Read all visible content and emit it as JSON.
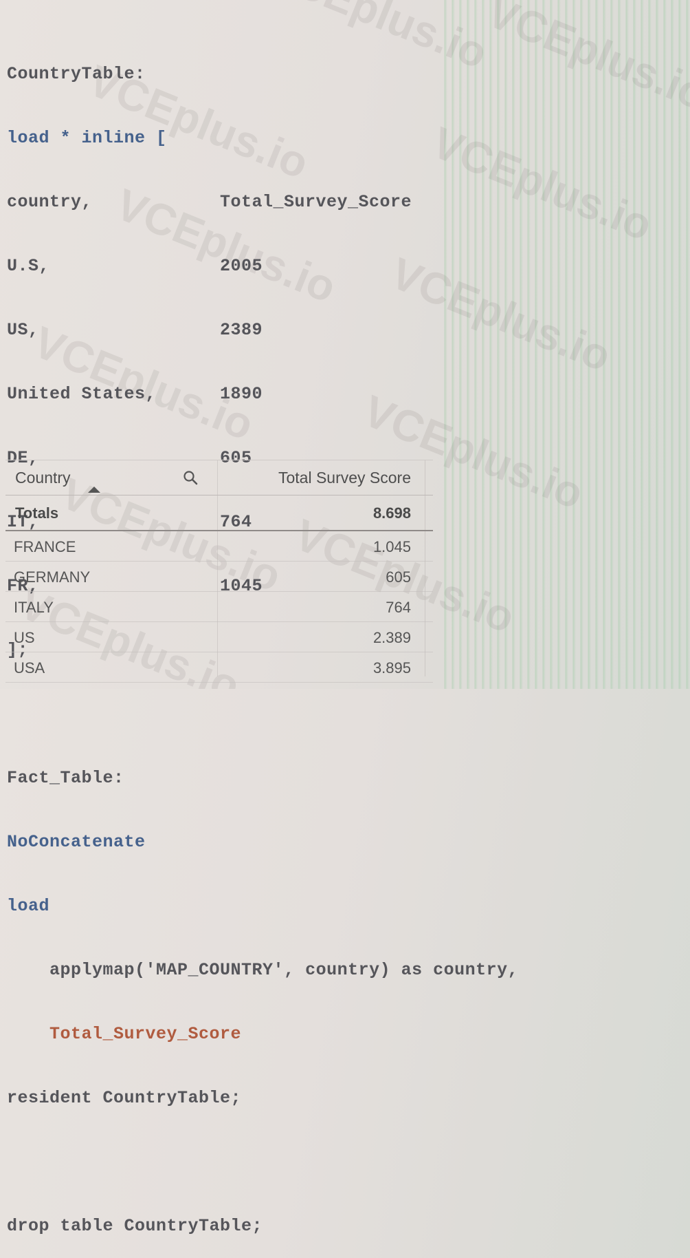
{
  "watermark": {
    "text": "VCEplus.io"
  },
  "script": {
    "lines": [
      {
        "a": "CountryTable:",
        "b": ""
      },
      {
        "a": "load * inline [",
        "b": ""
      },
      {
        "a": "country,",
        "b": "Total_Survey_Score"
      },
      {
        "a": "U.S,",
        "b": "2005"
      },
      {
        "a": "US,",
        "b": "2389"
      },
      {
        "a": "United States,",
        "b": "1890"
      },
      {
        "a": "DE,",
        "b": "605"
      },
      {
        "a": "IT,",
        "b": "764"
      },
      {
        "a": "FR,",
        "b": "1045"
      },
      {
        "a": "];",
        "b": ""
      },
      {
        "a": "",
        "b": ""
      },
      {
        "a": "Fact_Table:",
        "b": ""
      },
      {
        "a": "NoConcatenate",
        "b": ""
      },
      {
        "a": "load",
        "b": ""
      },
      {
        "a": "    applymap('MAP_COUNTRY', country) as country,",
        "b": ""
      },
      {
        "a": "    Total_Survey_Score",
        "b": ""
      },
      {
        "a": "resident CountryTable;",
        "b": ""
      },
      {
        "a": "",
        "b": ""
      },
      {
        "a": "drop table CountryTable;",
        "b": ""
      }
    ]
  },
  "table": {
    "header": {
      "country": "Country",
      "score": "Total Survey Score"
    },
    "totals": {
      "label": "Totals",
      "value": "8.698"
    },
    "rows": [
      {
        "country": "FRANCE",
        "score": "1.045"
      },
      {
        "country": "GERMANY",
        "score": "605"
      },
      {
        "country": "ITALY",
        "score": "764"
      },
      {
        "country": "US",
        "score": "2.389"
      },
      {
        "country": "USA",
        "score": "3.895"
      }
    ]
  },
  "icons": {
    "search": "search-icon",
    "sort": "sort-ascending-icon"
  },
  "colors": {
    "code_text": "#55555a",
    "keyword_blue": "#45618c",
    "field_orange": "#b05b3f"
  }
}
